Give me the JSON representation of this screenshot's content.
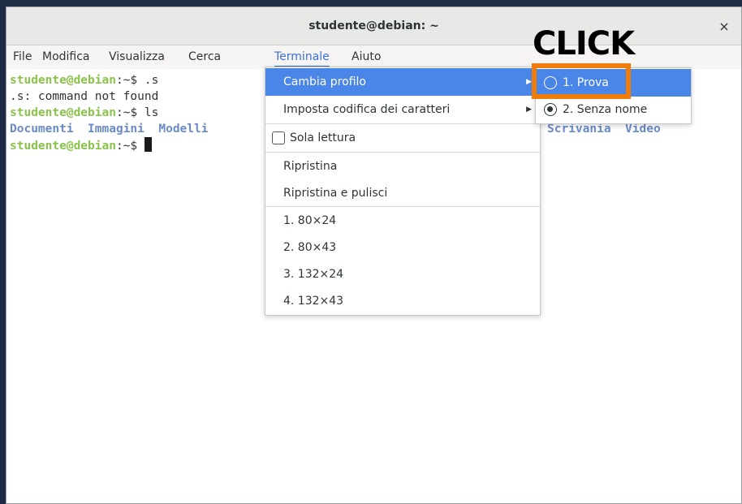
{
  "window": {
    "title": "studente@debian: ~",
    "close_icon": "×"
  },
  "menubar": {
    "items": [
      "File",
      "Modifica",
      "Visualizza",
      "Cerca",
      "Terminale",
      "Aiuto"
    ],
    "active": "Terminale"
  },
  "terminal": {
    "lines": [
      {
        "prompt": "studente@debian",
        "suffix": ":~$ ",
        "command": ".s"
      },
      {
        "text": ".s: command not found"
      },
      {
        "prompt": "studente@debian",
        "suffix": ":~$ ",
        "command": "ls"
      },
      {
        "dirs": [
          "Documenti",
          "Immagini",
          "Modelli",
          "Scrivania",
          "Video"
        ]
      },
      {
        "prompt": "studente@debian",
        "suffix": ":~$ ",
        "command": ""
      }
    ]
  },
  "menu": {
    "items": [
      "Cambia profilo",
      "Imposta codifica dei caratteri",
      "Sola lettura",
      "Ripristina",
      "Ripristina e pulisci",
      "1. 80×24",
      "2. 80×43",
      "3. 132×24",
      "4. 132×43"
    ]
  },
  "submenu": {
    "items": [
      "1. Prova",
      "2. Senza nome"
    ],
    "selected": "2. Senza nome"
  },
  "annotation": {
    "text": "CLICK",
    "color": "#f07d0a"
  }
}
